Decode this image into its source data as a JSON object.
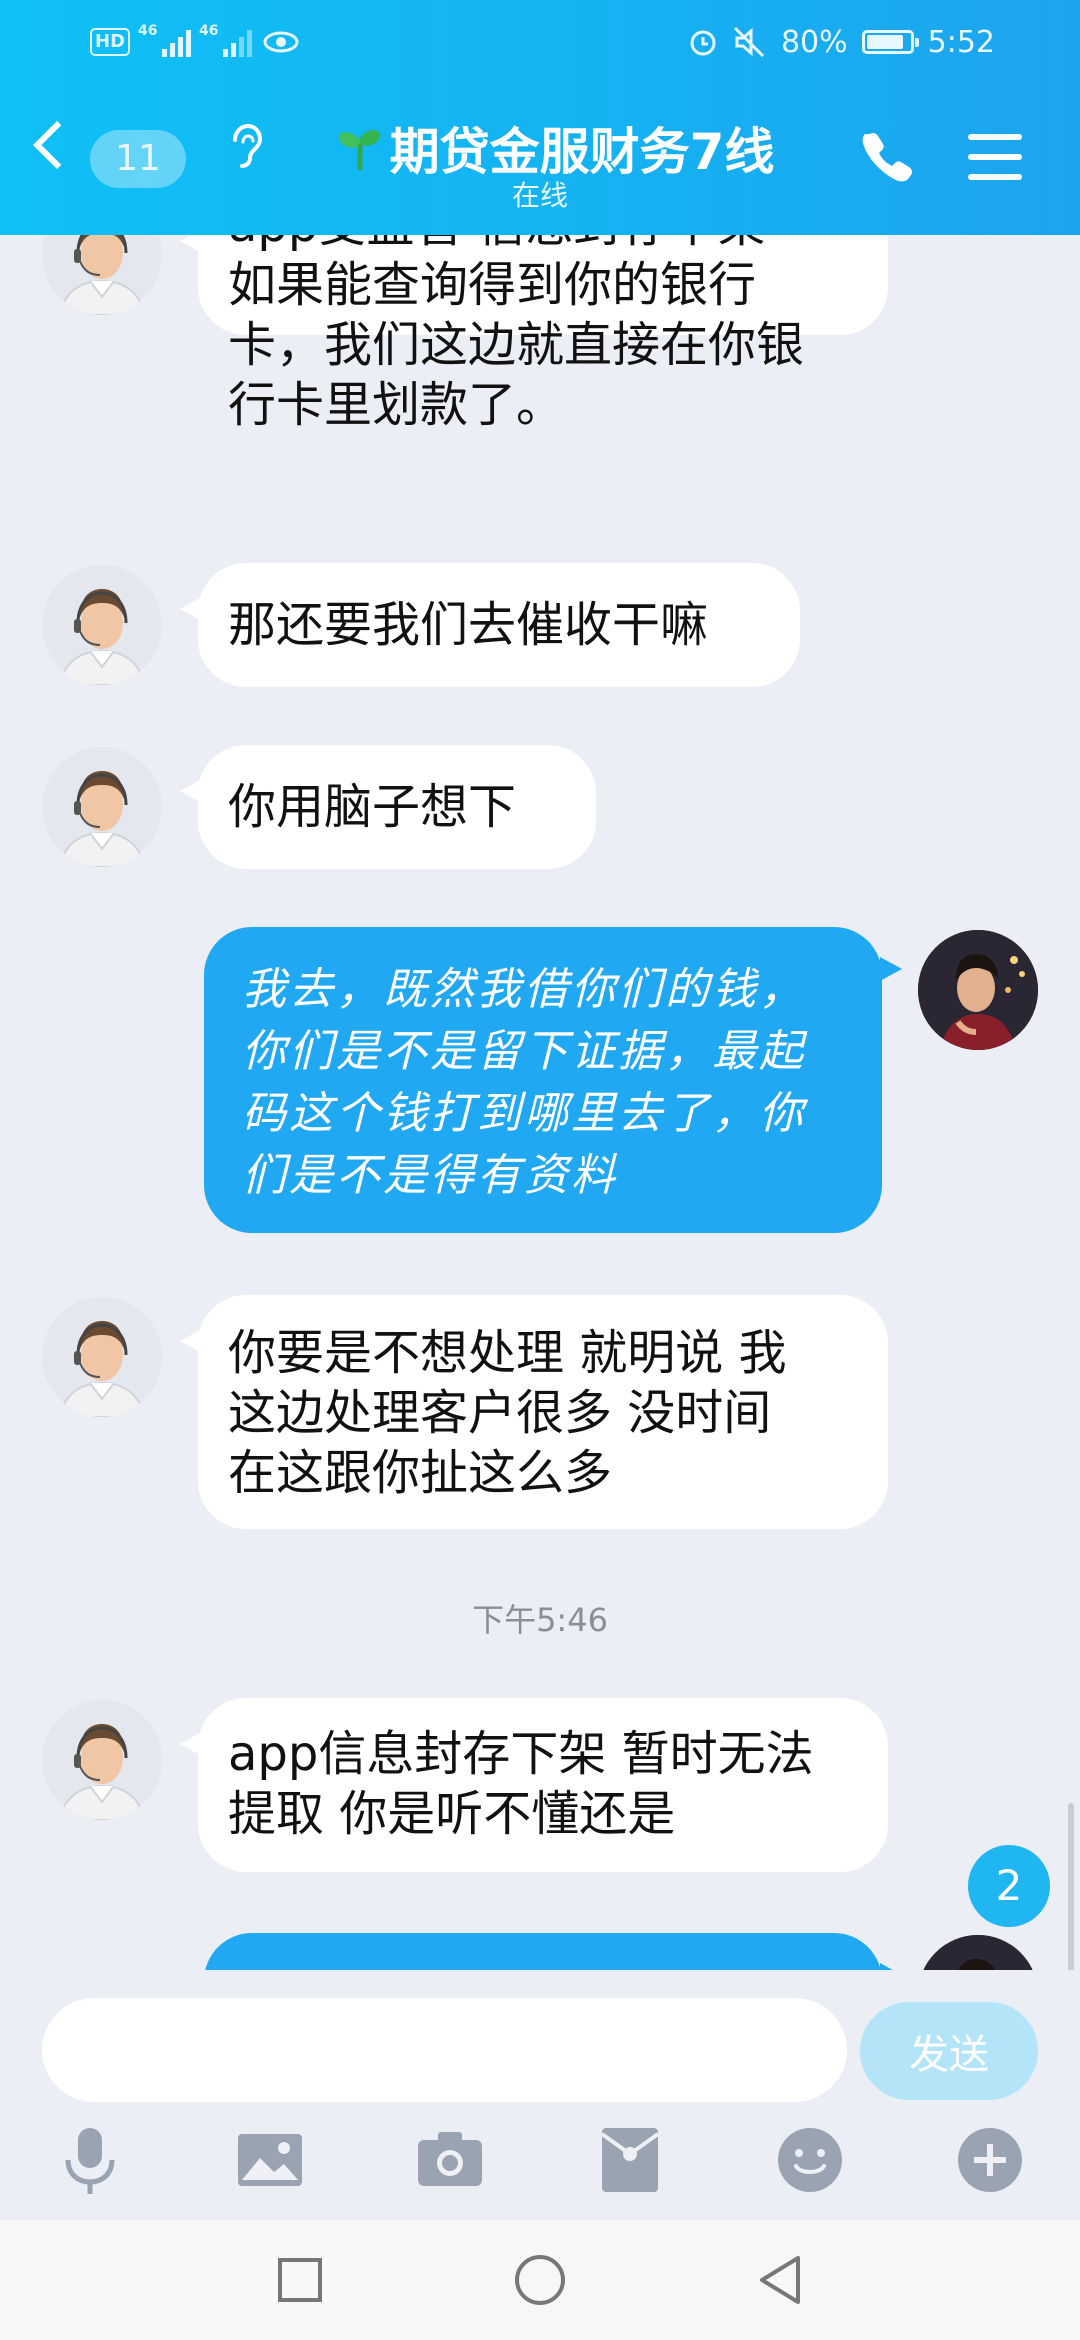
{
  "status_bar": {
    "hd": "HD",
    "signal1": "46",
    "signal2": "46",
    "battery": "80%",
    "time": "5:52"
  },
  "header": {
    "unread_count": "11",
    "title": "期贷金服财务7线",
    "subtitle": "在线"
  },
  "messages": [
    {
      "direction": "in",
      "text": "app受监管  信息封存下架\n如果能查询得到你的银行\n卡，我们这边就直接在你银\n行卡里划款了。"
    },
    {
      "direction": "in",
      "text": "那还要我们去催收干嘛"
    },
    {
      "direction": "in",
      "text": "你用脑子想下"
    },
    {
      "direction": "out",
      "text": "我去，既然我借你们的钱，\n你们是不是留下证据，最起\n码这个钱打到哪里去了，你\n们是不是得有资料"
    },
    {
      "direction": "in",
      "text": "你要是不想处理 就明说 我\n这边处理客户很多  没时间\n在这跟你扯这么多"
    },
    {
      "direction": "in",
      "text": "app信息封存下架  暂时无法\n提取  你是听不懂还是"
    }
  ],
  "timestamp": "下午5:46",
  "new_message_badge": "2",
  "input": {
    "value": "",
    "placeholder": "",
    "send_label": "发送"
  },
  "toolbar_icons": [
    "microphone-icon",
    "image-icon",
    "camera-icon",
    "red-packet-icon",
    "emoji-icon",
    "plus-icon"
  ],
  "colors": {
    "header": "#15b2f2",
    "outgoing_bubble": "#20a8f2",
    "background": "#ebeef5"
  }
}
